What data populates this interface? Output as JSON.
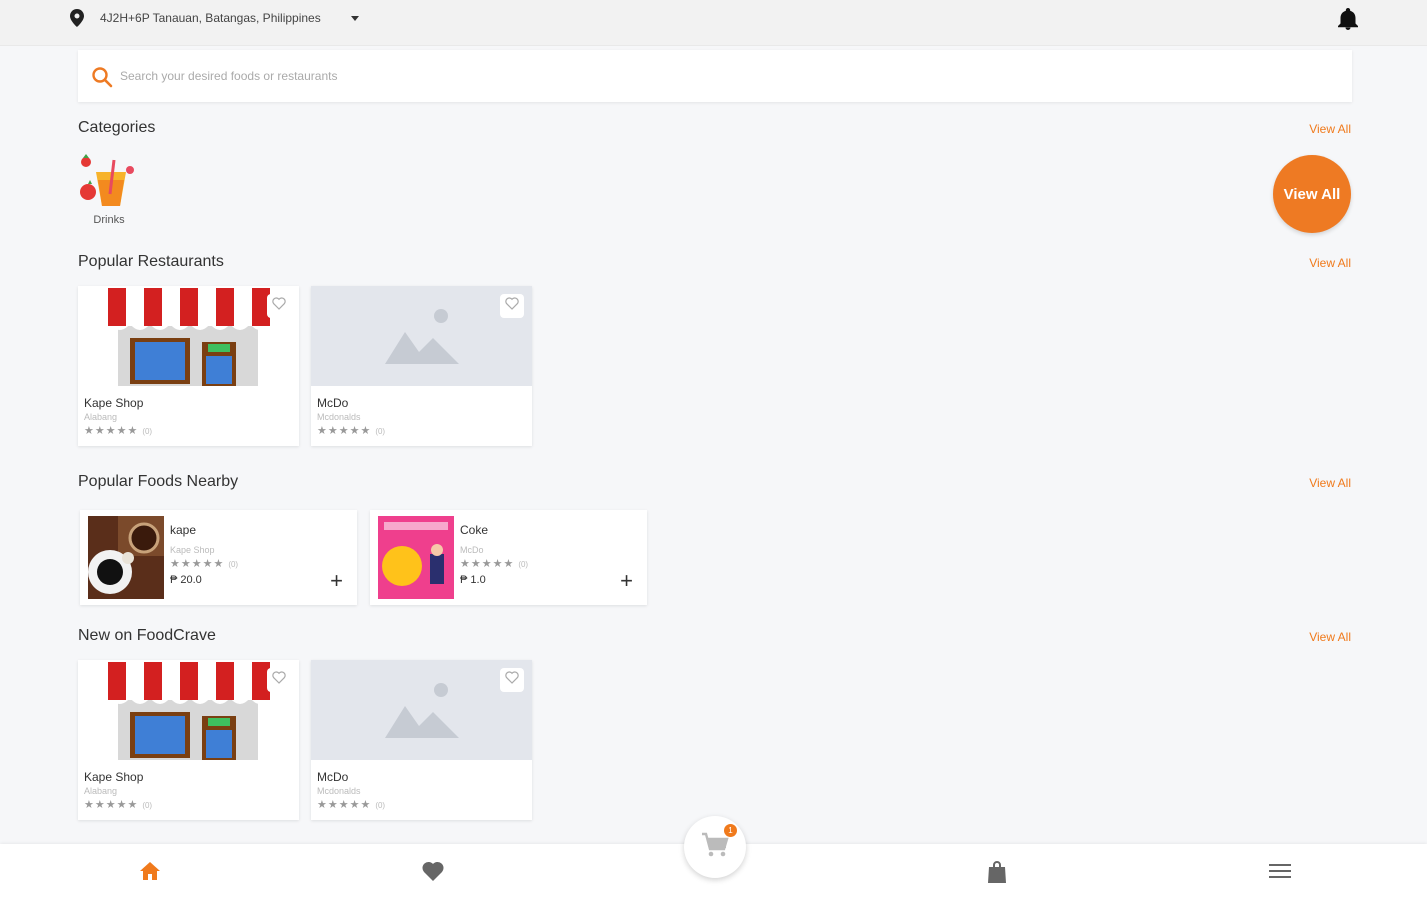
{
  "header": {
    "location": "4J2H+6P Tanauan, Batangas, Philippines"
  },
  "search": {
    "placeholder": "Search your desired foods or restaurants"
  },
  "categories": {
    "title": "Categories",
    "view_all": "View All",
    "items": [
      {
        "label": "Drinks",
        "icon": "drink-icon"
      }
    ],
    "view_all_button": "View All"
  },
  "popular_restaurants": {
    "title": "Popular Restaurants",
    "view_all": "View All",
    "items": [
      {
        "name": "Kape Shop",
        "subtitle": "Alabang",
        "stars": "★★★★★",
        "count": "(0)",
        "image": "storefront-icon"
      },
      {
        "name": "McDo",
        "subtitle": "Mcdonalds",
        "stars": "★★★★★",
        "count": "(0)",
        "image": "image-placeholder-icon"
      }
    ]
  },
  "popular_foods": {
    "title": "Popular Foods Nearby",
    "view_all": "View All",
    "items": [
      {
        "name": "kape",
        "subtitle": "Kape Shop",
        "stars": "★★★★★",
        "count": "(0)",
        "price": "₱ 20.0",
        "image": "coffee-photo"
      },
      {
        "name": "Coke",
        "subtitle": "McDo",
        "stars": "★★★★★",
        "count": "(0)",
        "price": "₱ 1.0",
        "image": "promo-photo"
      }
    ]
  },
  "new_on": {
    "title": "New on FoodCrave",
    "view_all": "View All",
    "items": [
      {
        "name": "Kape Shop",
        "subtitle": "Alabang",
        "stars": "★★★★★",
        "count": "(0)",
        "image": "storefront-icon"
      },
      {
        "name": "McDo",
        "subtitle": "Mcdonalds",
        "stars": "★★★★★",
        "count": "(0)",
        "image": "image-placeholder-icon"
      }
    ]
  },
  "bottom_nav": {
    "items": [
      "home-icon",
      "heart-icon",
      "bag-icon",
      "menu-icon"
    ],
    "cart_badge": "1"
  },
  "colors": {
    "accent": "#f07a1c",
    "background": "#f6f7f9"
  }
}
